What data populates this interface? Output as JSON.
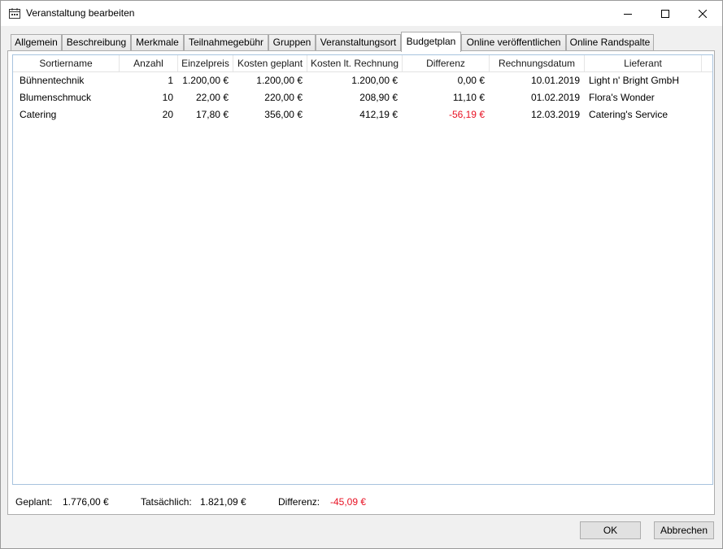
{
  "window": {
    "title": "Veranstaltung bearbeiten",
    "icon": "calendar-icon",
    "minimize_icon": "minimize-icon",
    "maximize_icon": "maximize-icon",
    "close_icon": "close-icon"
  },
  "tabs": [
    {
      "label": "Allgemein"
    },
    {
      "label": "Beschreibung"
    },
    {
      "label": "Merkmale"
    },
    {
      "label": "Teilnahmegebühr"
    },
    {
      "label": "Gruppen"
    },
    {
      "label": "Veranstaltungsort"
    },
    {
      "label": "Budgetplan",
      "active": true
    },
    {
      "label": "Online veröffentlichen"
    },
    {
      "label": "Online Randspalte"
    }
  ],
  "grid": {
    "columns": [
      "Sortiername",
      "Anzahl",
      "Einzelpreis",
      "Kosten geplant",
      "Kosten lt. Rechnung",
      "Differenz",
      "Rechnungsdatum",
      "Lieferant"
    ],
    "rows": [
      {
        "sortiername": "Bühnentechnik",
        "anzahl": "1",
        "einzelpreis": "1.200,00 €",
        "kosten_geplant": "1.200,00 €",
        "kosten_rechnung": "1.200,00 €",
        "differenz": "0,00 €",
        "rechnungsdatum": "10.01.2019",
        "lieferant": "Light n' Bright GmbH"
      },
      {
        "sortiername": "Blumenschmuck",
        "anzahl": "10",
        "einzelpreis": "22,00 €",
        "kosten_geplant": "220,00 €",
        "kosten_rechnung": "208,90 €",
        "differenz": "11,10 €",
        "rechnungsdatum": "01.02.2019",
        "lieferant": "Flora's Wonder"
      },
      {
        "sortiername": "Catering",
        "anzahl": "20",
        "einzelpreis": "17,80 €",
        "kosten_geplant": "356,00 €",
        "kosten_rechnung": "412,19 €",
        "differenz": "-56,19 €",
        "rechnungsdatum": "12.03.2019",
        "lieferant": "Catering's Service"
      }
    ]
  },
  "summary": {
    "geplant_label": "Geplant:",
    "geplant_value": "1.776,00 €",
    "tatsaechlich_label": "Tatsächlich:",
    "tatsaechlich_value": "1.821,09 €",
    "differenz_label": "Differenz:",
    "differenz_value": "-45,09 €"
  },
  "buttons": {
    "ok": "OK",
    "cancel": "Abbrechen"
  },
  "colors": {
    "negative": "#e81123",
    "grid_border": "#a7c3de"
  }
}
